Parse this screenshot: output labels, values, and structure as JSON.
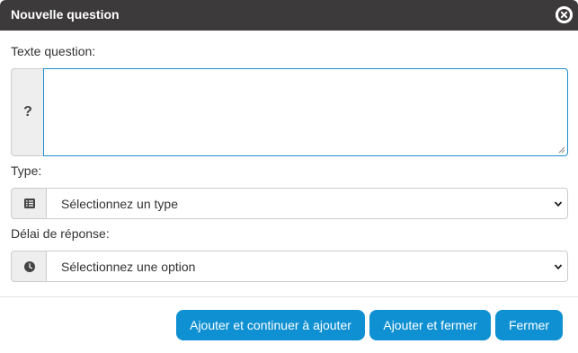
{
  "dialog": {
    "title": "Nouvelle question",
    "close_icon": "close-circle-icon"
  },
  "form": {
    "question_label": "Texte question:",
    "question_addon": "?",
    "question_value": "",
    "type_label": "Type:",
    "type_icon": "list-icon",
    "type_selected": "Sélectionnez un type",
    "delay_label": "Délai de réponse:",
    "delay_icon": "clock-icon",
    "delay_selected": "Sélectionnez une option"
  },
  "footer": {
    "add_continue_label": "Ajouter et continuer à ajouter",
    "add_close_label": "Ajouter et fermer",
    "close_label": "Fermer"
  },
  "colors": {
    "titlebar": "#3c3a3a",
    "primary_button": "#0e90d2",
    "focus_border": "#1f8ed1"
  }
}
